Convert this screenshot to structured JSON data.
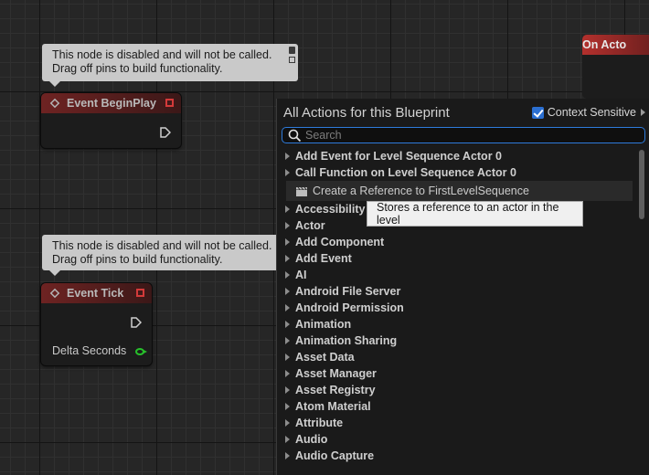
{
  "graph": {
    "comment_1": {
      "line1": "This node is disabled and will not be called.",
      "line2": "Drag off pins to build functionality."
    },
    "comment_2": {
      "line1": "This node is disabled and will not be called.",
      "line2": "Drag off pins to build functionality."
    },
    "node_begin_play": {
      "title": "Event BeginPlay"
    },
    "node_tick": {
      "title": "Event Tick",
      "pin_label": "Delta Seconds"
    },
    "node_on_actor": {
      "title": "On Acto"
    }
  },
  "menu": {
    "title": "All Actions for this Blueprint",
    "context_sensitive": {
      "label": "Context Sensitive",
      "checked": true
    },
    "search": {
      "placeholder": "Search",
      "value": ""
    },
    "items": [
      "Add Event for Level Sequence Actor 0",
      "Call Function on Level Sequence Actor 0",
      "Create a Reference to FirstLevelSequence",
      "Accessibility",
      "Actor",
      "Add Component",
      "Add Event",
      "AI",
      "Android File Server",
      "Android Permission",
      "Animation",
      "Animation Sharing",
      "Asset Data",
      "Asset Manager",
      "Asset Registry",
      "Atom Material",
      "Attribute",
      "Audio",
      "Audio Capture"
    ],
    "tooltip": "Stores a reference to an actor in the level"
  },
  "colors": {
    "accent": "#2e7bdb",
    "event_header": "#6e2322",
    "pin_green": "#27c02b"
  }
}
